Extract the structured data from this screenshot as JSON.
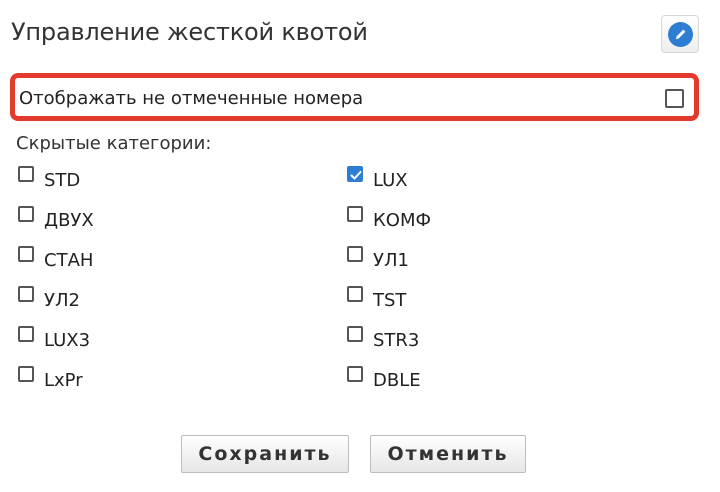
{
  "dialog": {
    "title": "Управление жесткой квотой",
    "edit_icon": "pencil-icon"
  },
  "highlight_option": {
    "label": "Отображать не отмеченные номера",
    "checked": false
  },
  "hidden_categories": {
    "title": "Скрытые категории:",
    "left": [
      {
        "label": "STD",
        "checked": false
      },
      {
        "label": "ДВУХ",
        "checked": false
      },
      {
        "label": "СТАН",
        "checked": false
      },
      {
        "label": "УЛ2",
        "checked": false
      },
      {
        "label": "LUX3",
        "checked": false
      },
      {
        "label": "LxPr",
        "checked": false
      }
    ],
    "right": [
      {
        "label": "LUX",
        "checked": true
      },
      {
        "label": "КОМФ",
        "checked": false
      },
      {
        "label": "УЛ1",
        "checked": false
      },
      {
        "label": "TST",
        "checked": false
      },
      {
        "label": "STR3",
        "checked": false
      },
      {
        "label": "DBLE",
        "checked": false
      }
    ]
  },
  "buttons": {
    "save": "Сохранить",
    "cancel": "Отменить"
  },
  "colors": {
    "accent": "#2d7dd2",
    "highlight_border": "#e23b2e"
  }
}
